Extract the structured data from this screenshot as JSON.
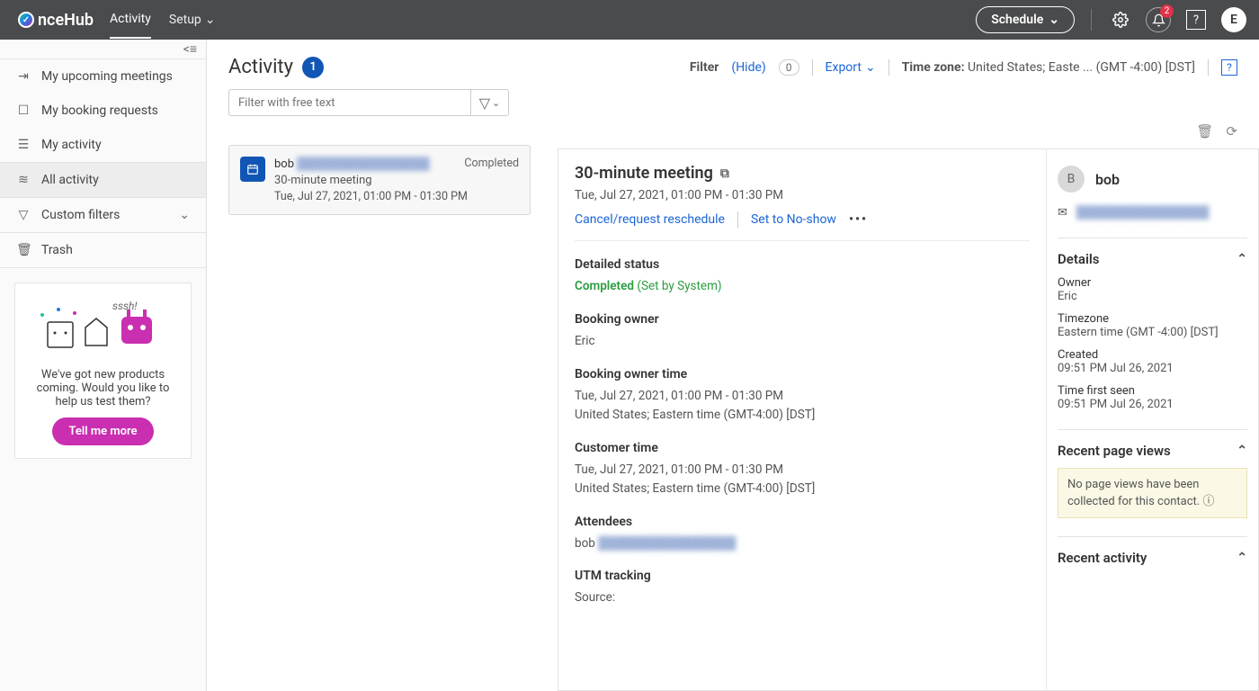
{
  "brand": "nceHub",
  "topnav": {
    "activity": "Activity",
    "setup": "Setup"
  },
  "schedule": "Schedule",
  "notif_count": "2",
  "avatar_letter": "E",
  "sidebar": {
    "upcoming": "My upcoming meetings",
    "requests": "My booking requests",
    "myactivity": "My activity",
    "all": "All activity",
    "custom": "Custom filters",
    "trash": "Trash",
    "promo_text": "We've got new products coming. Would you like to help us test them?",
    "promo_btn": "Tell me more",
    "promo_ssh": "sssh!"
  },
  "page": {
    "title": "Activity",
    "count": "1",
    "filter_label": "Filter",
    "hide": "(Hide)",
    "hide_count": "0",
    "export": "Export",
    "tz_label": "Time zone:",
    "tz_value": "United States; Easte ... (GMT -4:00) [DST]",
    "filter_placeholder": "Filter with free text"
  },
  "list": {
    "name": "bob",
    "email_redacted": "████████████████",
    "sub": "30-minute meeting",
    "time": "Tue, Jul 27, 2021, 01:00 PM - 01:30 PM",
    "status": "Completed"
  },
  "detail": {
    "title": "30-minute meeting",
    "time": "Tue, Jul 27, 2021, 01:00 PM - 01:30 PM",
    "cancel": "Cancel/request reschedule",
    "noshow": "Set to No-show",
    "status_h": "Detailed status",
    "status_val": "Completed",
    "status_by": "(Set by System)",
    "owner_h": "Booking owner",
    "owner": "Eric",
    "owner_time_h": "Booking owner time",
    "owner_time1": "Tue, Jul 27, 2021, 01:00 PM - 01:30 PM",
    "owner_time2": "United States; Eastern time (GMT-4:00) [DST]",
    "cust_time_h": "Customer time",
    "cust_time1": "Tue, Jul 27, 2021, 01:00 PM - 01:30 PM",
    "cust_time2": "United States; Eastern time (GMT-4:00) [DST]",
    "att_h": "Attendees",
    "att_name": "bob",
    "att_email_redacted": "████████████████",
    "utm_h": "UTM tracking",
    "utm_src": "Source:"
  },
  "contact": {
    "av": "B",
    "name": "bob",
    "email_redacted": "████████████████",
    "details_h": "Details",
    "owner_l": "Owner",
    "owner_v": "Eric",
    "tz_l": "Timezone",
    "tz_v": "Eastern time (GMT -4:00) [DST]",
    "created_l": "Created",
    "created_v": "09:51 PM Jul 26, 2021",
    "seen_l": "Time first seen",
    "seen_v": "09:51 PM Jul 26, 2021",
    "pv_h": "Recent page views",
    "pv_msg": "No page views have been collected for this contact.",
    "ra_h": "Recent activity"
  }
}
